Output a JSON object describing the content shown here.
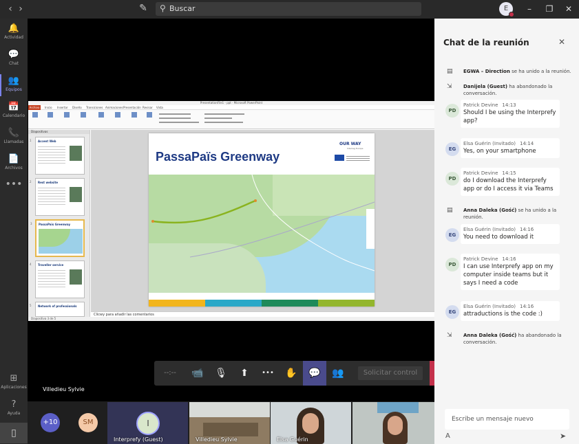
{
  "topbar": {
    "back_icon": "‹",
    "forward_icon": "›",
    "compose_icon": "✎",
    "search_placeholder": "Buscar",
    "search_icon": "⚲",
    "avatar_initial": "E",
    "minimize": "–",
    "maximize": "❐",
    "close": "✕"
  },
  "rail": {
    "items": [
      {
        "icon": "🔔",
        "label": "Actividad"
      },
      {
        "icon": "💬",
        "label": "Chat"
      },
      {
        "icon": "👥",
        "label": "Equipos"
      },
      {
        "icon": "📅",
        "label": "Calendario"
      },
      {
        "icon": "📞",
        "label": "Llamadas"
      },
      {
        "icon": "📄",
        "label": "Archivos"
      }
    ],
    "more": "•••",
    "apps": {
      "icon": "⊞",
      "label": "Aplicaciones"
    },
    "help": {
      "icon": "?",
      "label": "Ayuda"
    },
    "device_icon": "▯"
  },
  "ppt": {
    "window_title": "PresentationFile1 - ppt · Microsoft PowerPoint",
    "tabs": [
      "Archivo",
      "Inicio",
      "Insertar",
      "Diseño",
      "Transiciones",
      "Animaciones",
      "Presentación",
      "Revisar",
      "Vista"
    ],
    "thumbs_header": "Diapositivas",
    "thumbs": [
      {
        "num": "1",
        "title": "Accent Web"
      },
      {
        "num": "2",
        "title": "Rest website"
      },
      {
        "num": "3",
        "title": "PassaPaïs Greenway"
      },
      {
        "num": "4",
        "title": "Traveller service"
      },
      {
        "num": "5",
        "title": "Network of professionals"
      }
    ],
    "slide_title": "PassaPaïs Greenway",
    "logo": "OUR WAY",
    "logo_sub": "Interreg Europe",
    "notes_placeholder": "Clicwy para añadir las comentarios",
    "status": "Diapositiva 3 de 5"
  },
  "controls": {
    "timer": "--:--",
    "camera_icon": "📹",
    "mic_icon": "🎙",
    "share_icon": "⬆",
    "more_icon": "•••",
    "hand_icon": "✋",
    "chat_icon": "💬",
    "people_icon": "👥",
    "request_control": "Solicitar control",
    "hangup_icon": "☎"
  },
  "presenter_name": "Villedieu Sylvie",
  "participants": {
    "overflow": "+10",
    "sm_initials": "SM",
    "tiles": [
      {
        "label": "Interprefy (Guest)",
        "initial": "I"
      },
      {
        "label": "Villedieu Sylvie"
      },
      {
        "label": "Elsa Guérin"
      },
      {
        "label": ""
      }
    ]
  },
  "chat": {
    "title": "Chat de la reunión",
    "close_icon": "✕",
    "events": [
      {
        "name": "EGWA – Direction",
        "text": "se ha unido a la reunión."
      },
      {
        "name": "Danijela (Guest)",
        "text": "ha abandonado la conversación."
      },
      {
        "name": "Anna Daleka (Gość)",
        "text": "se ha unido a la reunión."
      },
      {
        "name": "Anna Daleka (Gość)",
        "text": "ha abandonado la conversación."
      }
    ],
    "messages": [
      {
        "initials": "PD",
        "author": "Patrick Devine",
        "time": "14:13",
        "text": "Should I be using the Interprefy app?"
      },
      {
        "initials": "EG",
        "author": "Elsa Guérin (Invitado)",
        "time": "14:14",
        "text": "Yes, on your smartphone"
      },
      {
        "initials": "PD",
        "author": "Patrick Devine",
        "time": "14:15",
        "text": "do I download the Interprefy app or do I access it via Teams"
      },
      {
        "initials": "EG",
        "author": "Elsa Guérin (Invitado)",
        "time": "14:16",
        "text": "You need to download it"
      },
      {
        "initials": "PD",
        "author": "Patrick Devine",
        "time": "14:16",
        "text": "I can use Interprefy app on my computer inside teams but it says I need a code"
      },
      {
        "initials": "EG",
        "author": "Elsa Guérin (Invitado)",
        "time": "14:16",
        "text": "attraductions is the code :)"
      }
    ],
    "compose_placeholder": "Escribe un mensaje nuevo",
    "format_icon": "A",
    "send_icon": "➤"
  }
}
